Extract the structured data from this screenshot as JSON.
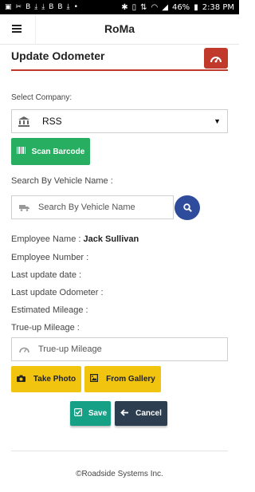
{
  "status_bar": {
    "left_icons": [
      "image-icon",
      "b-app-icon",
      "b-app-icon",
      "download-icon",
      "download-icon",
      "b-app-icon",
      "b-app-icon",
      "download-icon",
      "dots-icon"
    ],
    "battery": "46%",
    "time": "2:38 PM",
    "right_icons": [
      "bluetooth-icon",
      "vibrate-icon",
      "data-icon",
      "wifi-icon",
      "signal-icon",
      "battery-icon"
    ]
  },
  "app_bar": {
    "title": "RoMa"
  },
  "page": {
    "title": "Update Odometer"
  },
  "company": {
    "label": "Select Company:",
    "value": "RSS"
  },
  "scan": {
    "label": "Scan Barcode"
  },
  "search": {
    "label": "Search By Vehicle Name :",
    "placeholder": "Search By Vehicle Name"
  },
  "info": {
    "employee_name_label": "Employee Name :",
    "employee_name_value": "Jack Sullivan",
    "employee_number_label": "Employee Number :",
    "last_update_date_label": "Last update date :",
    "last_update_odometer_label": "Last update Odometer :",
    "estimated_mileage_label": "Estimated Mileage :",
    "trueup_mileage_label": "True-up Mileage :"
  },
  "trueup": {
    "placeholder": "True-up Mileage"
  },
  "buttons": {
    "take_photo": "Take Photo",
    "from_gallery": "From Gallery",
    "save": "Save",
    "cancel": "Cancel"
  },
  "footer": {
    "text": "©Roadside Systems Inc."
  },
  "colors": {
    "accent_red": "#c0392b",
    "scan_green": "#27ae60",
    "search_blue": "#2f4b9b",
    "yellow": "#f1c40f",
    "save_teal": "#16a085",
    "cancel_navy": "#2c3e50"
  }
}
